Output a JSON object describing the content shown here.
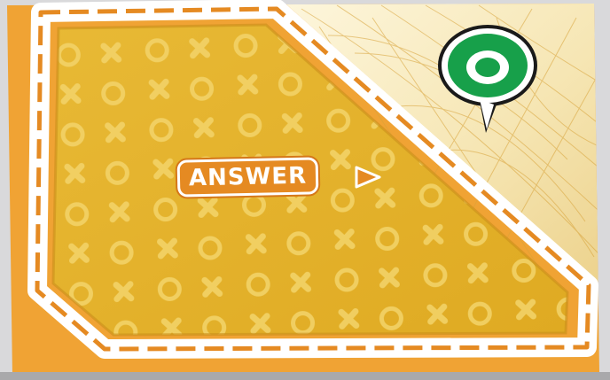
{
  "card": {
    "button_label": "ANSWER",
    "colors": {
      "card_orange": "#f0a334",
      "panel_yellow": "#e3b52a",
      "badge_green": "#17a04a",
      "label_orange": "#e58a22"
    },
    "icons": [
      "o-x-pattern",
      "speech-bubble-icon",
      "play-arrow-icon"
    ]
  }
}
